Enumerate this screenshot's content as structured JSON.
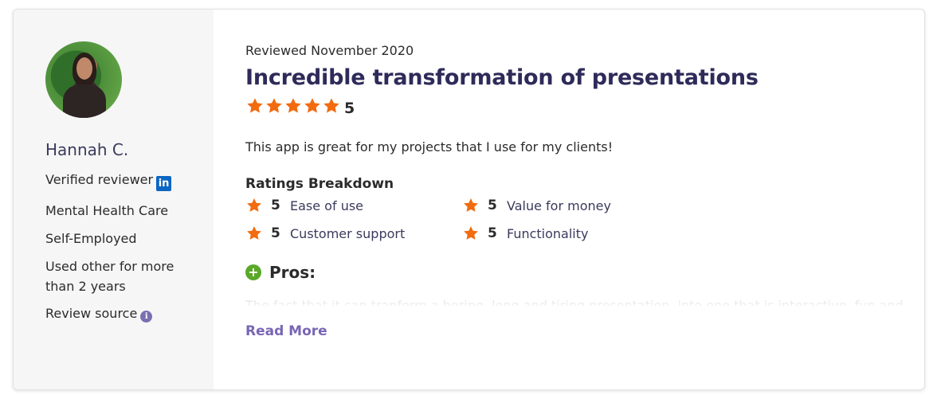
{
  "reviewer": {
    "name": "Hannah C.",
    "verified_label": "Verified reviewer",
    "linkedin_badge": "in",
    "industry": "Mental Health Care",
    "company_size": "Self-Employed",
    "usage": "Used other for more than 2 years",
    "review_source_label": "Review source",
    "info_glyph": "i"
  },
  "review": {
    "date": "Reviewed November 2020",
    "title": "Incredible transformation of presentations",
    "overall_score": "5",
    "overall_rating": 5,
    "body": "This app is great for my projects that I use for my clients!",
    "breakdown_title": "Ratings Breakdown",
    "breakdown": [
      {
        "score": "5",
        "label": "Ease of use"
      },
      {
        "score": "5",
        "label": "Value for money"
      },
      {
        "score": "5",
        "label": "Customer support"
      },
      {
        "score": "5",
        "label": "Functionality"
      }
    ],
    "pros_label": "Pros:",
    "pros_glyph": "+",
    "pros_text": "The fact that it can tranform a boring, long and tiring presentation, into one that is interactive, fun and",
    "read_more": "Read More"
  },
  "colors": {
    "star": "#f26b0f",
    "accent": "#7866b5",
    "title": "#2e2b5a",
    "pros_icon": "#5ba829",
    "linkedin": "#0a66c2"
  },
  "icons": {
    "star": "star-icon",
    "linkedin": "linkedin-icon",
    "info": "info-icon",
    "plus": "plus-circle-icon"
  }
}
